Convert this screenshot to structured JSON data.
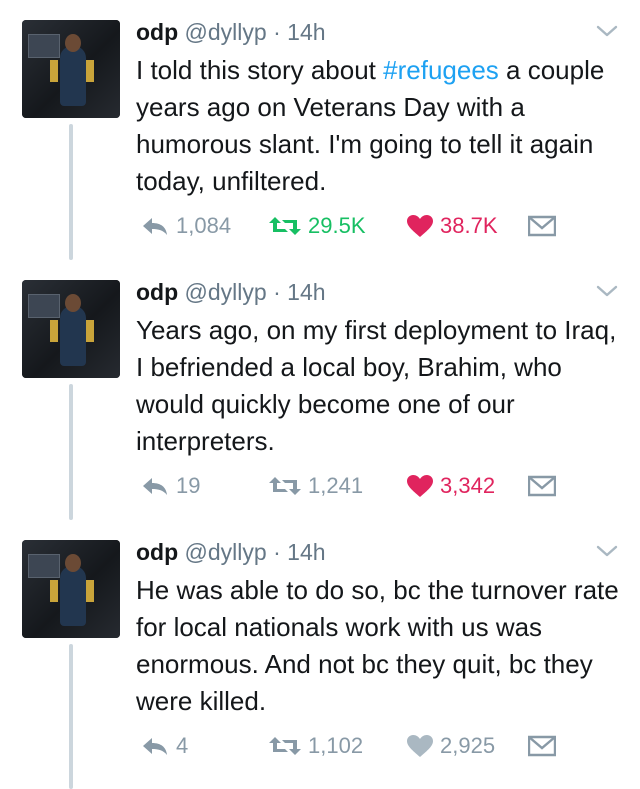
{
  "colors": {
    "retweet_active": "#17bf63",
    "like_active": "#e0245e",
    "muted": "#8899a6",
    "hashtag": "#1da1f2"
  },
  "tweets": [
    {
      "name": "odp",
      "handle": "@dyllyp",
      "dot": "·",
      "time": "14h",
      "text_before": "I told this story about ",
      "hashtag": "#refugees",
      "text_after": " a couple years ago on Veterans Day with a humorous slant. I'm going to tell it again today, unfiltered.",
      "replies": "1,084",
      "retweets": "29.5K",
      "likes": "38.7K",
      "retweeted": true,
      "liked": true
    },
    {
      "name": "odp",
      "handle": "@dyllyp",
      "dot": "·",
      "time": "14h",
      "text_before": "Years ago, on my first deployment to Iraq, I befriended a local boy, Brahim, who would quickly become one of our interpreters.",
      "hashtag": "",
      "text_after": "",
      "replies": "19",
      "retweets": "1,241",
      "likes": "3,342",
      "retweeted": false,
      "liked": true
    },
    {
      "name": "odp",
      "handle": "@dyllyp",
      "dot": "·",
      "time": "14h",
      "text_before": "He was able to do so, bc the turnover rate for local nationals work with us was enormous. And not bc they quit, bc they were killed.",
      "hashtag": "",
      "text_after": "",
      "replies": "4",
      "retweets": "1,102",
      "likes": "2,925",
      "retweeted": false,
      "liked": false
    }
  ]
}
